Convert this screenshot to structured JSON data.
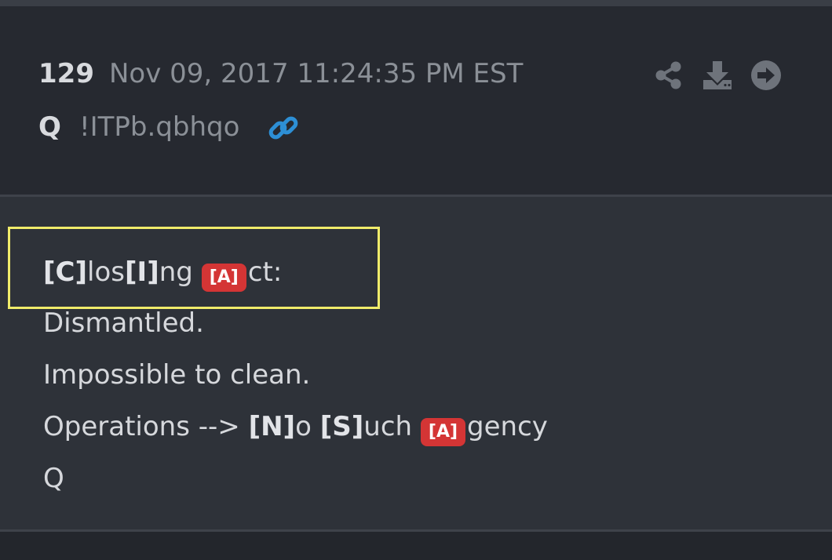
{
  "post": {
    "number": "129",
    "date": "Nov 09, 2017 11:24:35 PM EST",
    "author": "Q",
    "tripcode": "!ITPb.qbhqo"
  },
  "actions": {
    "share_icon": "share-icon",
    "download_icon": "download-icon",
    "next_icon": "arrow-circle-right-icon",
    "link_icon": "link-icon"
  },
  "message": {
    "line1": {
      "p1": "[C]",
      "p2": "los",
      "p3": "[I]",
      "p4": "ng ",
      "badge": "[A]",
      "p5": "ct:"
    },
    "line2": "Dismantled.",
    "line3": "Impossible to clean.",
    "line4": {
      "p1": "Operations --> ",
      "p2": "[N]",
      "p3": "o ",
      "p4": "[S]",
      "p5": "uch ",
      "badge": "[A]",
      "p6": "gency"
    },
    "line5": "Q"
  },
  "colors": {
    "badge": "#d43535",
    "link": "#2d8fd5",
    "highlight": "#f0ec6a"
  }
}
